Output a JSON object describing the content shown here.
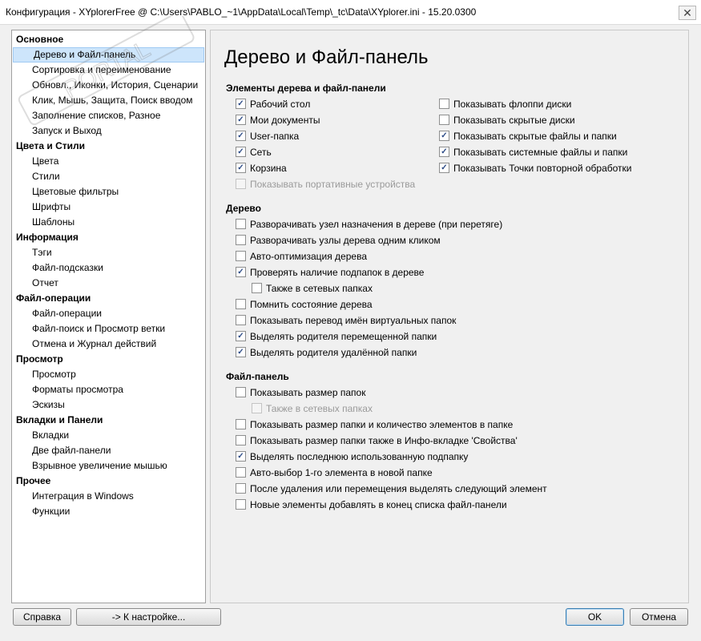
{
  "window": {
    "title": "Конфигурация - XYplorerFree @ C:\\Users\\PABLO_~1\\AppData\\Local\\Temp\\_tc\\Data\\XYplorer.ini - 15.20.0300",
    "close_glyph": "✕"
  },
  "watermark": {
    "text": "PORTAL"
  },
  "tree": {
    "items": [
      {
        "label": "Основное",
        "level": 0
      },
      {
        "label": "Дерево и Файл-панель",
        "level": 1,
        "selected": true
      },
      {
        "label": "Сортировка и переименование",
        "level": 1
      },
      {
        "label": "Обновл., Иконки, История, Сценарии",
        "level": 1
      },
      {
        "label": "Клик, Мышь, Защита, Поиск вводом",
        "level": 1
      },
      {
        "label": "Заполнение списков, Разное",
        "level": 1
      },
      {
        "label": "Запуск и Выход",
        "level": 1
      },
      {
        "label": "Цвета и Стили",
        "level": 0
      },
      {
        "label": "Цвета",
        "level": 1
      },
      {
        "label": "Стили",
        "level": 1
      },
      {
        "label": "Цветовые фильтры",
        "level": 1
      },
      {
        "label": "Шрифты",
        "level": 1
      },
      {
        "label": "Шаблоны",
        "level": 1
      },
      {
        "label": "Информация",
        "level": 0
      },
      {
        "label": "Тэги",
        "level": 1
      },
      {
        "label": "Файл-подсказки",
        "level": 1
      },
      {
        "label": "Отчет",
        "level": 1
      },
      {
        "label": "Файл-операции",
        "level": 0
      },
      {
        "label": "Файл-операции",
        "level": 1
      },
      {
        "label": "Файл-поиск и Просмотр ветки",
        "level": 1
      },
      {
        "label": "Отмена и Журнал действий",
        "level": 1
      },
      {
        "label": "Просмотр",
        "level": 0
      },
      {
        "label": "Просмотр",
        "level": 1
      },
      {
        "label": "Форматы просмотра",
        "level": 1
      },
      {
        "label": "Эскизы",
        "level": 1
      },
      {
        "label": "Вкладки и Панели",
        "level": 0
      },
      {
        "label": "Вкладки",
        "level": 1
      },
      {
        "label": "Две файл-панели",
        "level": 1
      },
      {
        "label": "Взрывное увеличение мышью",
        "level": 1
      },
      {
        "label": "Прочее",
        "level": 0
      },
      {
        "label": "Интеграция в Windows",
        "level": 1
      },
      {
        "label": "Функции",
        "level": 1
      }
    ]
  },
  "panel": {
    "title": "Дерево и Файл-панель",
    "section1": {
      "heading": "Элементы дерева и файл-панели",
      "left": [
        {
          "label": "Рабочий стол",
          "checked": true
        },
        {
          "label": "Мои документы",
          "checked": true
        },
        {
          "label": "User-папка",
          "checked": true
        },
        {
          "label": "Сеть",
          "checked": true
        },
        {
          "label": "Корзина",
          "checked": true
        },
        {
          "label": "Показывать портативные устройства",
          "checked": false,
          "disabled": true
        }
      ],
      "right": [
        {
          "label": "Показывать флоппи диски",
          "checked": false
        },
        {
          "label": "Показывать скрытые диски",
          "checked": false
        },
        {
          "label": "Показывать скрытые файлы и папки",
          "checked": true
        },
        {
          "label": "Показывать системные файлы и папки",
          "checked": true
        },
        {
          "label": "Показывать Точки повторной обработки",
          "checked": true
        }
      ]
    },
    "section2": {
      "heading": "Дерево",
      "items": [
        {
          "label": "Разворачивать узел назначения в дереве (при перетяге)",
          "checked": false
        },
        {
          "label": "Разворачивать узлы дерева одним кликом",
          "checked": false
        },
        {
          "label": "Авто-оптимизация дерева",
          "checked": false
        },
        {
          "label": "Проверять наличие подпапок в дереве",
          "checked": true
        },
        {
          "label": "Также в сетевых папках",
          "checked": false,
          "indent": true
        },
        {
          "label": "Помнить состояние дерева",
          "checked": false
        },
        {
          "label": "Показывать перевод имён виртуальных папок",
          "checked": false
        },
        {
          "label": "Выделять родителя перемещенной папки",
          "checked": true
        },
        {
          "label": "Выделять родителя удалённой папки",
          "checked": true
        }
      ]
    },
    "section3": {
      "heading": "Файл-панель",
      "items": [
        {
          "label": "Показывать размер папок",
          "checked": false
        },
        {
          "label": "Также в сетевых папках",
          "checked": false,
          "indent": true,
          "disabled": true
        },
        {
          "label": "Показывать размер папки и количество элементов в папке",
          "checked": false
        },
        {
          "label": "Показывать размер папки также в Инфо-вкладке 'Свойства'",
          "checked": false
        },
        {
          "label": "Выделять последнюю использованную подпапку",
          "checked": true
        },
        {
          "label": "Авто-выбор 1-го элемента в новой папке",
          "checked": false
        },
        {
          "label": "После удаления или перемещения выделять следующий элемент",
          "checked": false
        },
        {
          "label": "Новые элементы добавлять в конец списка файл-панели",
          "checked": false
        }
      ]
    }
  },
  "buttons": {
    "help": "Справка",
    "goto": "-> К настройке...",
    "ok": "OK",
    "cancel": "Отмена"
  },
  "check_glyph": "✓"
}
